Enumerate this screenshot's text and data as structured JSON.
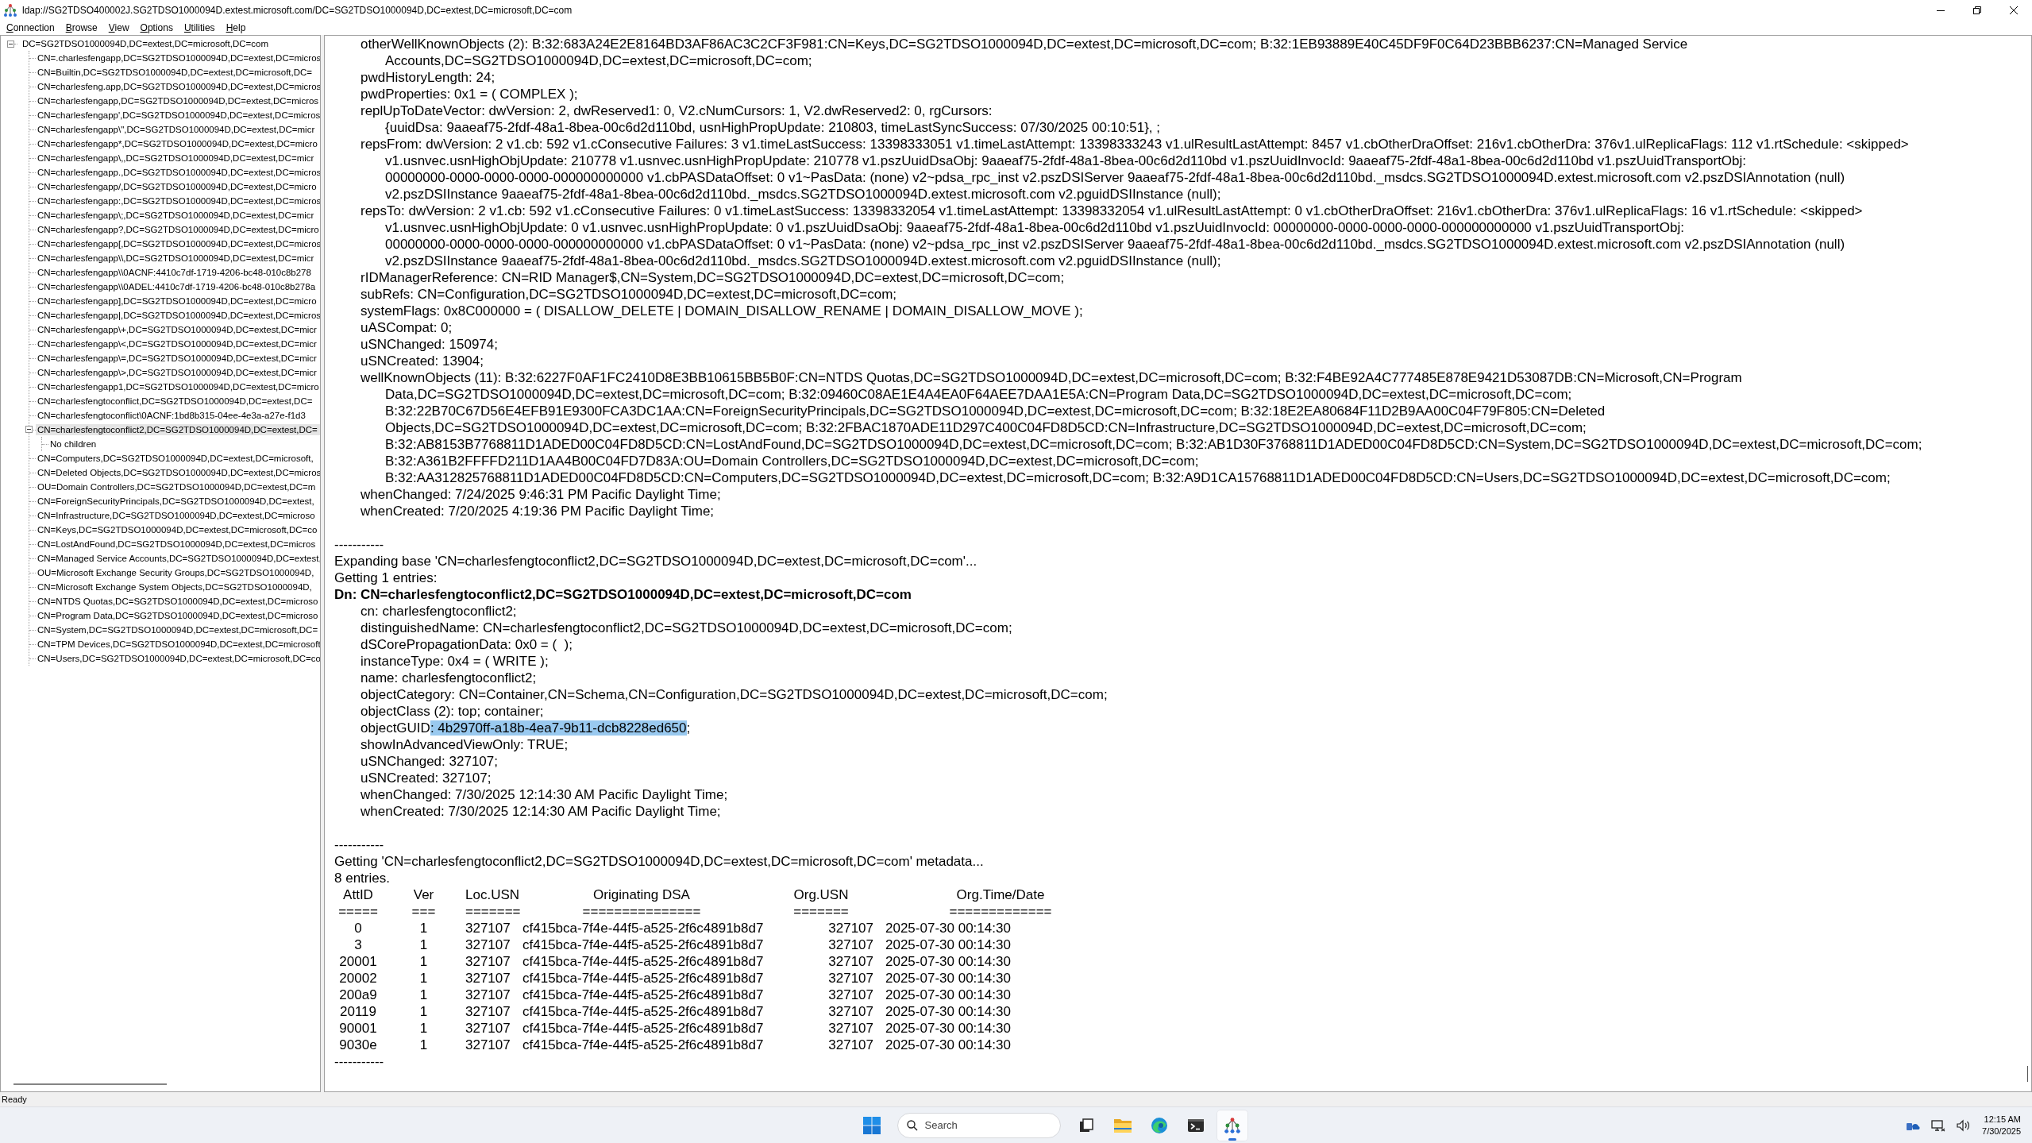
{
  "window": {
    "title": "ldap://SG2TDSO400002J.SG2TDSO1000094D.extest.microsoft.com/DC=SG2TDSO1000094D,DC=extest,DC=microsoft,DC=com"
  },
  "menu": [
    "Connection",
    "Browse",
    "View",
    "Options",
    "Utilities",
    "Help"
  ],
  "tree": {
    "nodes": [
      {
        "label": "DC=SG2TDSO1000094D,DC=extest,DC=microsoft,DC=com",
        "expanded": true,
        "selected": false,
        "children": [
          {
            "label": "CN=.charlesfengapp,DC=SG2TDSO1000094D,DC=extest,DC=micros",
            "expanded": false,
            "selected": false
          },
          {
            "label": "CN=Builtin,DC=SG2TDSO1000094D,DC=extest,DC=microsoft,DC=",
            "expanded": false,
            "selected": false
          },
          {
            "label": "CN=charlesfeng.app,DC=SG2TDSO1000094D,DC=extest,DC=micros",
            "expanded": false,
            "selected": false
          },
          {
            "label": "CN=charlesfengapp,DC=SG2TDSO1000094D,DC=extest,DC=micros",
            "expanded": false,
            "selected": false
          },
          {
            "label": "CN=charlesfengapp',DC=SG2TDSO1000094D,DC=extest,DC=micros",
            "expanded": false,
            "selected": false
          },
          {
            "label": "CN=charlesfengapp\\\",DC=SG2TDSO1000094D,DC=extest,DC=micr",
            "expanded": false,
            "selected": false
          },
          {
            "label": "CN=charlesfengapp*,DC=SG2TDSO1000094D,DC=extest,DC=micro",
            "expanded": false,
            "selected": false
          },
          {
            "label": "CN=charlesfengapp\\,,DC=SG2TDSO1000094D,DC=extest,DC=micr",
            "expanded": false,
            "selected": false
          },
          {
            "label": "CN=charlesfengapp.,DC=SG2TDSO1000094D,DC=extest,DC=micros",
            "expanded": false,
            "selected": false
          },
          {
            "label": "CN=charlesfengapp/,DC=SG2TDSO1000094D,DC=extest,DC=micro",
            "expanded": false,
            "selected": false
          },
          {
            "label": "CN=charlesfengapp:,DC=SG2TDSO1000094D,DC=extest,DC=micros",
            "expanded": false,
            "selected": false
          },
          {
            "label": "CN=charlesfengapp\\;,DC=SG2TDSO1000094D,DC=extest,DC=micr",
            "expanded": false,
            "selected": false
          },
          {
            "label": "CN=charlesfengapp?,DC=SG2TDSO1000094D,DC=extest,DC=micro",
            "expanded": false,
            "selected": false
          },
          {
            "label": "CN=charlesfengapp[,DC=SG2TDSO1000094D,DC=extest,DC=micros",
            "expanded": false,
            "selected": false
          },
          {
            "label": "CN=charlesfengapp\\\\,DC=SG2TDSO1000094D,DC=extest,DC=micr",
            "expanded": false,
            "selected": false
          },
          {
            "label": "CN=charlesfengapp\\\\0ACNF:4410c7df-1719-4206-bc48-010c8b278",
            "expanded": false,
            "selected": false
          },
          {
            "label": "CN=charlesfengapp\\\\0ADEL:4410c7df-1719-4206-bc48-010c8b278a",
            "expanded": false,
            "selected": false
          },
          {
            "label": "CN=charlesfengapp],DC=SG2TDSO1000094D,DC=extest,DC=micro",
            "expanded": false,
            "selected": false
          },
          {
            "label": "CN=charlesfengapp|,DC=SG2TDSO1000094D,DC=extest,DC=micros",
            "expanded": false,
            "selected": false
          },
          {
            "label": "CN=charlesfengapp\\+,DC=SG2TDSO1000094D,DC=extest,DC=micr",
            "expanded": false,
            "selected": false
          },
          {
            "label": "CN=charlesfengapp\\<,DC=SG2TDSO1000094D,DC=extest,DC=micr",
            "expanded": false,
            "selected": false
          },
          {
            "label": "CN=charlesfengapp\\=,DC=SG2TDSO1000094D,DC=extest,DC=micr",
            "expanded": false,
            "selected": false
          },
          {
            "label": "CN=charlesfengapp\\>,DC=SG2TDSO1000094D,DC=extest,DC=micr",
            "expanded": false,
            "selected": false
          },
          {
            "label": "CN=charlesfengapp1,DC=SG2TDSO1000094D,DC=extest,DC=micro",
            "expanded": false,
            "selected": false
          },
          {
            "label": "CN=charlesfengtoconflict,DC=SG2TDSO1000094D,DC=extest,DC=",
            "expanded": false,
            "selected": false
          },
          {
            "label": "CN=charlesfengtoconflict\\0ACNF:1bd8b315-04ee-4e3a-a27e-f1d3",
            "expanded": false,
            "selected": false
          },
          {
            "label": "CN=charlesfengtoconflict2,DC=SG2TDSO1000094D,DC=extest,DC=",
            "expanded": true,
            "selected": true,
            "children": [
              {
                "label": "No children",
                "expanded": false,
                "selected": false
              }
            ]
          },
          {
            "label": "CN=Computers,DC=SG2TDSO1000094D,DC=extest,DC=microsoft,",
            "expanded": false,
            "selected": false
          },
          {
            "label": "CN=Deleted Objects,DC=SG2TDSO1000094D,DC=extest,DC=micros",
            "expanded": false,
            "selected": false
          },
          {
            "label": "OU=Domain Controllers,DC=SG2TDSO1000094D,DC=extest,DC=m",
            "expanded": false,
            "selected": false
          },
          {
            "label": "CN=ForeignSecurityPrincipals,DC=SG2TDSO1000094D,DC=extest,",
            "expanded": false,
            "selected": false
          },
          {
            "label": "CN=Infrastructure,DC=SG2TDSO1000094D,DC=extest,DC=microso",
            "expanded": false,
            "selected": false
          },
          {
            "label": "CN=Keys,DC=SG2TDSO1000094D,DC=extest,DC=microsoft,DC=co",
            "expanded": false,
            "selected": false
          },
          {
            "label": "CN=LostAndFound,DC=SG2TDSO1000094D,DC=extest,DC=micros",
            "expanded": false,
            "selected": false
          },
          {
            "label": "CN=Managed Service Accounts,DC=SG2TDSO1000094D,DC=extest,",
            "expanded": false,
            "selected": false
          },
          {
            "label": "OU=Microsoft Exchange Security Groups,DC=SG2TDSO1000094D,",
            "expanded": false,
            "selected": false
          },
          {
            "label": "CN=Microsoft Exchange System Objects,DC=SG2TDSO1000094D,",
            "expanded": false,
            "selected": false
          },
          {
            "label": "CN=NTDS Quotas,DC=SG2TDSO1000094D,DC=extest,DC=microso",
            "expanded": false,
            "selected": false
          },
          {
            "label": "CN=Program Data,DC=SG2TDSO1000094D,DC=extest,DC=microso",
            "expanded": false,
            "selected": false
          },
          {
            "label": "CN=System,DC=SG2TDSO1000094D,DC=extest,DC=microsoft,DC=",
            "expanded": false,
            "selected": false
          },
          {
            "label": "CN=TPM Devices,DC=SG2TDSO1000094D,DC=extest,DC=microsoft",
            "expanded": false,
            "selected": false
          },
          {
            "label": "CN=Users,DC=SG2TDSO1000094D,DC=extest,DC=microsoft,DC=co",
            "expanded": false,
            "selected": false
          }
        ]
      }
    ]
  },
  "output": {
    "lines": [
      {
        "kind": "attr",
        "lines": [
          "otherWellKnownObjects (2): B:32:683A24E2E8164BD3AF86AC3C2CF3F981:CN=Keys,DC=SG2TDSO1000094D,DC=extest,DC=microsoft,DC=com; B:32:1EB93889E40C45DF9F0C64D23BBB6237:CN=Managed Service",
          "Accounts,DC=SG2TDSO1000094D,DC=extest,DC=microsoft,DC=com;"
        ]
      },
      {
        "kind": "attr",
        "lines": [
          "pwdHistoryLength: 24;"
        ]
      },
      {
        "kind": "attr",
        "lines": [
          "pwdProperties: 0x1 = ( COMPLEX );"
        ]
      },
      {
        "kind": "attr",
        "lines": [
          "replUpToDateVector: dwVersion: 2, dwReserved1: 0, V2.cNumCursors: 1, V2.dwReserved2: 0, rgCursors:",
          "{uuidDsa: 9aaeaf75-2fdf-48a1-8bea-00c6d2d110bd, usnHighPropUpdate: 210803, timeLastSyncSuccess: 07/30/2025 00:10:51}, ;"
        ]
      },
      {
        "kind": "attr",
        "lines": [
          "repsFrom: dwVersion: 2 v1.cb: 592 v1.cConsecutive Failures: 3 v1.timeLastSuccess: 13398333051 v1.timeLastAttempt: 13398333243 v1.ulResultLastAttempt: 8457 v1.cbOtherDraOffset: 216v1.cbOtherDra: 376v1.ulReplicaFlags: 112 v1.rtSchedule: <skipped>",
          "v1.usnvec.usnHighObjUpdate: 210778 v1.usnvec.usnHighPropUpdate: 210778 v1.pszUuidDsaObj: 9aaeaf75-2fdf-48a1-8bea-00c6d2d110bd v1.pszUuidInvocId: 9aaeaf75-2fdf-48a1-8bea-00c6d2d110bd v1.pszUuidTransportObj:",
          "00000000-0000-0000-0000-000000000000 v1.cbPASDataOffset: 0 v1~PasData: (none) v2~pdsa_rpc_inst v2.pszDSIServer 9aaeaf75-2fdf-48a1-8bea-00c6d2d110bd._msdcs.SG2TDSO1000094D.extest.microsoft.com v2.pszDSIAnnotation (null)",
          "v2.pszDSIInstance 9aaeaf75-2fdf-48a1-8bea-00c6d2d110bd._msdcs.SG2TDSO1000094D.extest.microsoft.com v2.pguidDSIInstance (null);"
        ]
      },
      {
        "kind": "attr",
        "lines": [
          "repsTo: dwVersion: 2 v1.cb: 592 v1.cConsecutive Failures: 0 v1.timeLastSuccess: 13398332054 v1.timeLastAttempt: 13398332054 v1.ulResultLastAttempt: 0 v1.cbOtherDraOffset: 216v1.cbOtherDra: 376v1.ulReplicaFlags: 16 v1.rtSchedule: <skipped>",
          "v1.usnvec.usnHighObjUpdate: 0 v1.usnvec.usnHighPropUpdate: 0 v1.pszUuidDsaObj: 9aaeaf75-2fdf-48a1-8bea-00c6d2d110bd v1.pszUuidInvocId: 00000000-0000-0000-0000-000000000000 v1.pszUuidTransportObj:",
          "00000000-0000-0000-0000-000000000000 v1.cbPASDataOffset: 0 v1~PasData: (none) v2~pdsa_rpc_inst v2.pszDSIServer 9aaeaf75-2fdf-48a1-8bea-00c6d2d110bd._msdcs.SG2TDSO1000094D.extest.microsoft.com v2.pszDSIAnnotation (null)",
          "v2.pszDSIInstance 9aaeaf75-2fdf-48a1-8bea-00c6d2d110bd._msdcs.SG2TDSO1000094D.extest.microsoft.com v2.pguidDSIInstance (null);"
        ]
      },
      {
        "kind": "attr",
        "lines": [
          "rIDManagerReference: CN=RID Manager$,CN=System,DC=SG2TDSO1000094D,DC=extest,DC=microsoft,DC=com;"
        ]
      },
      {
        "kind": "attr",
        "lines": [
          "subRefs: CN=Configuration,DC=SG2TDSO1000094D,DC=extest,DC=microsoft,DC=com;"
        ]
      },
      {
        "kind": "attr",
        "lines": [
          "systemFlags: 0x8C000000 = ( DISALLOW_DELETE | DOMAIN_DISALLOW_RENAME | DOMAIN_DISALLOW_MOVE );"
        ]
      },
      {
        "kind": "attr",
        "lines": [
          "uASCompat: 0;"
        ]
      },
      {
        "kind": "attr",
        "lines": [
          "uSNChanged: 150974;"
        ]
      },
      {
        "kind": "attr",
        "lines": [
          "uSNCreated: 13904;"
        ]
      },
      {
        "kind": "attr",
        "lines": [
          "wellKnownObjects (11): B:32:6227F0AF1FC2410D8E3BB10615BB5B0F:CN=NTDS Quotas,DC=SG2TDSO1000094D,DC=extest,DC=microsoft,DC=com; B:32:F4BE92A4C777485E878E9421D53087DB:CN=Microsoft,CN=Program",
          "Data,DC=SG2TDSO1000094D,DC=extest,DC=microsoft,DC=com; B:32:09460C08AE1E4A4EA0F64AEE7DAA1E5A:CN=Program Data,DC=SG2TDSO1000094D,DC=extest,DC=microsoft,DC=com;",
          "B:32:22B70C67D56E4EFB91E9300FCA3DC1AA:CN=ForeignSecurityPrincipals,DC=SG2TDSO1000094D,DC=extest,DC=microsoft,DC=com; B:32:18E2EA80684F11D2B9AA00C04F79F805:CN=Deleted",
          "Objects,DC=SG2TDSO1000094D,DC=extest,DC=microsoft,DC=com; B:32:2FBAC1870ADE11D297C400C04FD8D5CD:CN=Infrastructure,DC=SG2TDSO1000094D,DC=extest,DC=microsoft,DC=com;",
          "B:32:AB8153B7768811D1ADED00C04FD8D5CD:CN=LostAndFound,DC=SG2TDSO1000094D,DC=extest,DC=microsoft,DC=com; B:32:AB1D30F3768811D1ADED00C04FD8D5CD:CN=System,DC=SG2TDSO1000094D,DC=extest,DC=microsoft,DC=com;",
          "B:32:A361B2FFFFD211D1AA4B00C04FD7D83A:OU=Domain Controllers,DC=SG2TDSO1000094D,DC=extest,DC=microsoft,DC=com;",
          "B:32:AA312825768811D1ADED00C04FD8D5CD:CN=Computers,DC=SG2TDSO1000094D,DC=extest,DC=microsoft,DC=com; B:32:A9D1CA15768811D1ADED00C04FD8D5CD:CN=Users,DC=SG2TDSO1000094D,DC=extest,DC=microsoft,DC=com;"
        ]
      },
      {
        "kind": "attr",
        "lines": [
          "whenChanged: 7/24/2025 9:46:31 PM Pacific Daylight Time;"
        ]
      },
      {
        "kind": "attr",
        "lines": [
          "whenCreated: 7/20/2025 4:19:36 PM Pacific Daylight Time;"
        ]
      },
      {
        "kind": "gap"
      },
      {
        "kind": "separator",
        "text": "-----------"
      },
      {
        "kind": "plain",
        "text": "Expanding base 'CN=charlesfengtoconflict2,DC=SG2TDSO1000094D,DC=extest,DC=microsoft,DC=com'..."
      },
      {
        "kind": "plain",
        "text": "Getting 1 entries:"
      },
      {
        "kind": "dn",
        "text": "Dn: CN=charlesfengtoconflict2,DC=SG2TDSO1000094D,DC=extest,DC=microsoft,DC=com"
      },
      {
        "kind": "attr",
        "lines": [
          "cn: charlesfengtoconflict2;"
        ]
      },
      {
        "kind": "attr",
        "lines": [
          "distinguishedName: CN=charlesfengtoconflict2,DC=SG2TDSO1000094D,DC=extest,DC=microsoft,DC=com;"
        ]
      },
      {
        "kind": "attr",
        "lines": [
          "dSCorePropagationData: 0x0 = (  );"
        ]
      },
      {
        "kind": "attr",
        "lines": [
          "instanceType: 0x4 = ( WRITE );"
        ]
      },
      {
        "kind": "attr",
        "lines": [
          "name: charlesfengtoconflict2;"
        ]
      },
      {
        "kind": "attr",
        "lines": [
          "objectCategory: CN=Container,CN=Schema,CN=Configuration,DC=SG2TDSO1000094D,DC=extest,DC=microsoft,DC=com;"
        ]
      },
      {
        "kind": "attr",
        "lines": [
          "objectClass (2): top; container;"
        ]
      },
      {
        "kind": "attr_selection",
        "text": "objectGUID",
        "selected_text": ": 4b2970ff-a18b-4ea7-9b11-dcb8228ed650",
        "tail": ";"
      },
      {
        "kind": "attr",
        "lines": [
          "showInAdvancedViewOnly: TRUE;"
        ]
      },
      {
        "kind": "attr",
        "lines": [
          "uSNChanged: 327107;"
        ]
      },
      {
        "kind": "attr",
        "lines": [
          "uSNCreated: 327107;"
        ]
      },
      {
        "kind": "attr",
        "lines": [
          "whenChanged: 7/30/2025 12:14:30 AM Pacific Daylight Time;"
        ]
      },
      {
        "kind": "attr",
        "lines": [
          "whenCreated: 7/30/2025 12:14:30 AM Pacific Daylight Time;"
        ]
      },
      {
        "kind": "gap"
      },
      {
        "kind": "separator",
        "text": "-----------"
      },
      {
        "kind": "plain",
        "text": "Getting 'CN=charlesfengtoconflict2,DC=SG2TDSO1000094D,DC=extest,DC=microsoft,DC=com' metadata..."
      },
      {
        "kind": "plain",
        "text": "8 entries."
      },
      {
        "kind": "table",
        "columns": [
          "AttID",
          "Ver",
          "Loc.USN",
          "Originating DSA",
          "Org.USN",
          "Org.Time/Date"
        ],
        "rules": [
          "=====",
          "===",
          "=======",
          "===============",
          "=======",
          "============="
        ],
        "rows": [
          [
            "0",
            "1",
            "327107",
            "cf415bca-7f4e-44f5-a525-2f6c4891b8d7",
            "327107",
            "2025-07-30 00:14:30"
          ],
          [
            "3",
            "1",
            "327107",
            "cf415bca-7f4e-44f5-a525-2f6c4891b8d7",
            "327107",
            "2025-07-30 00:14:30"
          ],
          [
            "20001",
            "1",
            "327107",
            "cf415bca-7f4e-44f5-a525-2f6c4891b8d7",
            "327107",
            "2025-07-30 00:14:30"
          ],
          [
            "20002",
            "1",
            "327107",
            "cf415bca-7f4e-44f5-a525-2f6c4891b8d7",
            "327107",
            "2025-07-30 00:14:30"
          ],
          [
            "200a9",
            "1",
            "327107",
            "cf415bca-7f4e-44f5-a525-2f6c4891b8d7",
            "327107",
            "2025-07-30 00:14:30"
          ],
          [
            "20119",
            "1",
            "327107",
            "cf415bca-7f4e-44f5-a525-2f6c4891b8d7",
            "327107",
            "2025-07-30 00:14:30"
          ],
          [
            "90001",
            "1",
            "327107",
            "cf415bca-7f4e-44f5-a525-2f6c4891b8d7",
            "327107",
            "2025-07-30 00:14:30"
          ],
          [
            "9030e",
            "1",
            "327107",
            "cf415bca-7f4e-44f5-a525-2f6c4891b8d7",
            "327107",
            "2025-07-30 00:14:30"
          ]
        ]
      },
      {
        "kind": "separator",
        "text": "-----------"
      }
    ]
  },
  "status_bar": {
    "text": "Ready"
  },
  "taskbar": {
    "search": {
      "placeholder": "Search"
    },
    "apps": [
      {
        "kind": "start",
        "active": false
      },
      {
        "kind": "taskview",
        "active": false
      },
      {
        "kind": "files",
        "active": false
      },
      {
        "kind": "browser",
        "active": false
      },
      {
        "kind": "terminal",
        "active": false
      },
      {
        "kind": "ldp",
        "active": true
      }
    ],
    "clock": {
      "time": "12:15 AM",
      "date": "7/30/2025"
    }
  }
}
